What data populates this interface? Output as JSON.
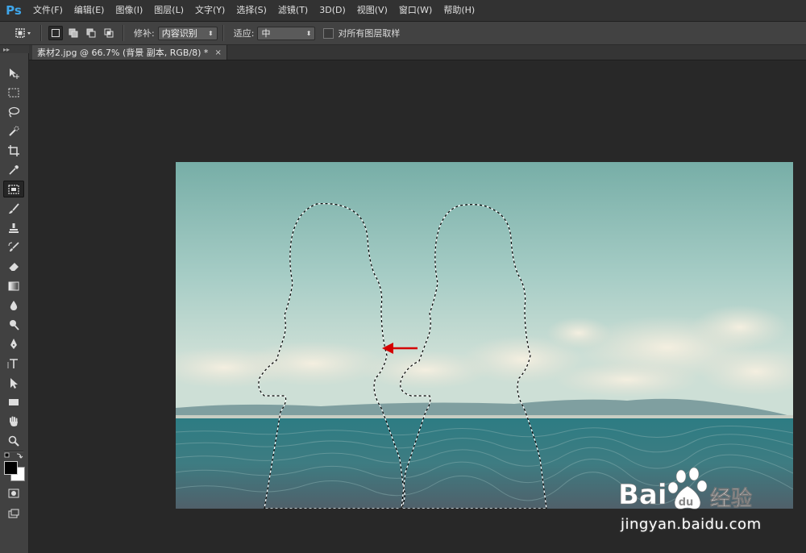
{
  "app": {
    "logo_text": "Ps"
  },
  "menu": [
    "文件(F)",
    "编辑(E)",
    "图像(I)",
    "图层(L)",
    "文字(Y)",
    "选择(S)",
    "滤镜(T)",
    "3D(D)",
    "视图(V)",
    "窗口(W)",
    "帮助(H)"
  ],
  "options": {
    "patch_label": "修补:",
    "patch_value": "内容识别",
    "adapt_label": "适应:",
    "adapt_value": "中",
    "sample_all_label": "对所有图层取样",
    "sample_all_checked": false
  },
  "document": {
    "tab_title": "素材2.jpg @ 66.7% (背景 副本, RGB/8) *",
    "close_glyph": "×"
  },
  "toolbar": {
    "active_tool": "patch-tool",
    "tools": [
      "move-tool",
      "marquee-tool",
      "lasso-tool",
      "quick-selection-tool",
      "crop-tool",
      "eyedropper-tool",
      "patch-tool",
      "brush-tool",
      "clone-stamp-tool",
      "history-brush-tool",
      "eraser-tool",
      "gradient-tool",
      "blur-tool",
      "dodge-tool",
      "pen-tool",
      "type-tool",
      "path-selection-tool",
      "rectangle-tool",
      "hand-tool",
      "zoom-tool"
    ],
    "foreground_color": "#000000",
    "background_color": "#ffffff"
  },
  "canvas": {
    "annotation_arrow_color": "#d40000"
  },
  "watermark": {
    "logo_text": "Bai du 经验",
    "url": "jingyan.baidu.com"
  }
}
